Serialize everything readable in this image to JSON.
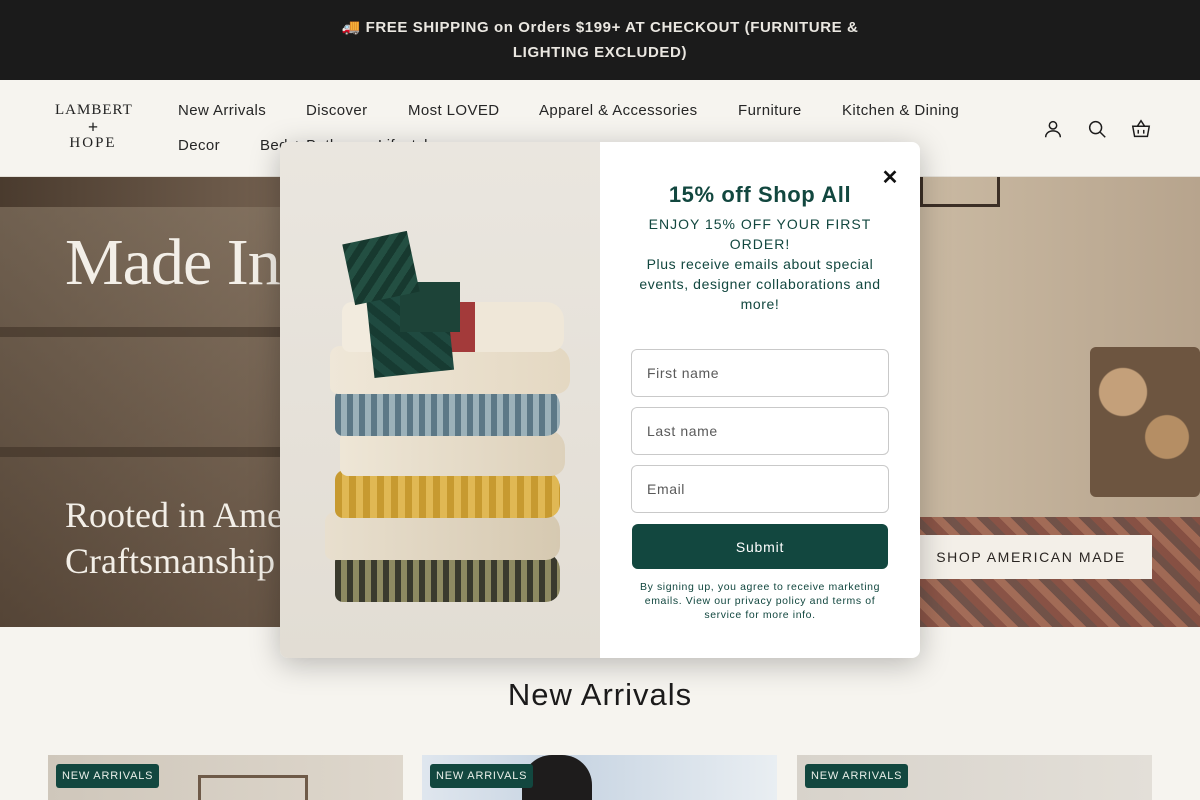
{
  "announcement": {
    "text": "🚚 FREE SHIPPING on Orders $199+ AT CHECKOUT (FURNITURE & LIGHTING EXCLUDED)"
  },
  "brand": {
    "line1": "LAMBERT",
    "line2": "+",
    "line3": "HOPE"
  },
  "nav": {
    "items": [
      {
        "label": "New Arrivals"
      },
      {
        "label": "Discover"
      },
      {
        "label": "Most LOVED"
      },
      {
        "label": "Apparel & Accessories"
      },
      {
        "label": "Furniture"
      },
      {
        "label": "Kitchen & Dining"
      },
      {
        "label": "Decor"
      },
      {
        "label": "Bed + Bath"
      },
      {
        "label": "Lifestyle"
      }
    ]
  },
  "header_icons": [
    "account-icon",
    "search-icon",
    "cart-icon"
  ],
  "hero": {
    "title": "Made In",
    "subtitle": "Rooted in American Craftsmanship",
    "cta": "SHOP AMERICAN MADE"
  },
  "section": {
    "title": "New Arrivals"
  },
  "products": [
    {
      "badge": "NEW ARRIVALS"
    },
    {
      "badge": "NEW ARRIVALS"
    },
    {
      "badge": "NEW ARRIVALS"
    }
  ],
  "popup": {
    "title": "15% off Shop All",
    "line1": "ENJOY 15% OFF YOUR FIRST ORDER!",
    "line2": "Plus receive emails about special events, designer collaborations and more!",
    "first_name_placeholder": "First name",
    "last_name_placeholder": "Last name",
    "email_placeholder": "Email",
    "submit_label": "Submit",
    "legal": "By signing up, you agree to receive marketing emails. View our privacy policy and terms of service for more info.",
    "close_icon": "close-icon"
  },
  "colors": {
    "accent": "#12473f",
    "announcement_bg": "#1b1b1b",
    "page_bg": "#f6f4ef"
  }
}
